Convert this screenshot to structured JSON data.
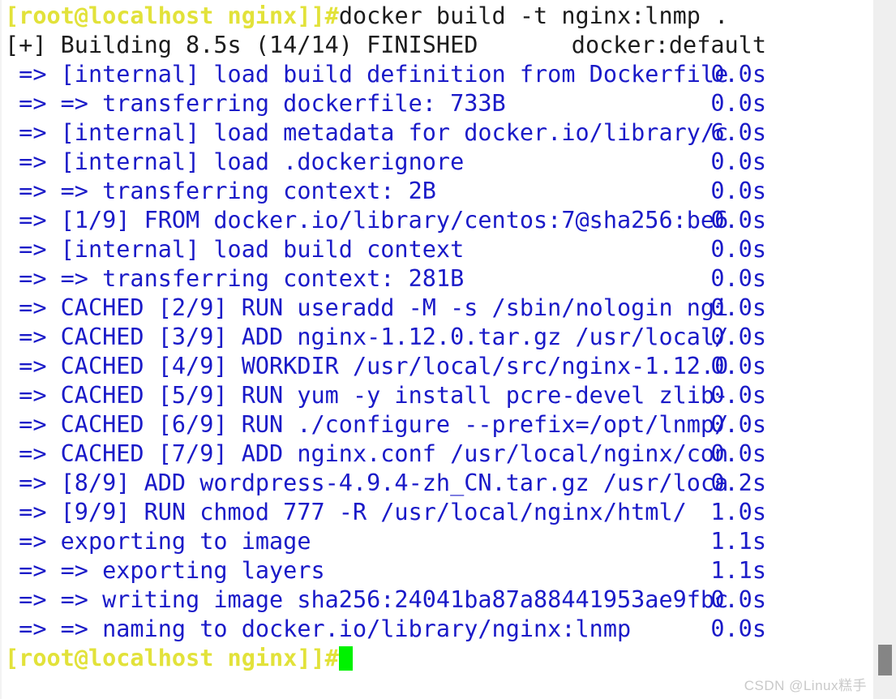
{
  "terminal": {
    "colors": {
      "background": "#ffffff",
      "prompt": "#e2e23a",
      "command": "#1c1c1c",
      "step": "#1a1ac8",
      "cursor": "#00f200",
      "scrollbar_track": "#efefef",
      "scrollbar_thumb": "#858585",
      "watermark": "#c9c9c9"
    },
    "prompt_text": "[root@localhost nginx]]#",
    "command": "docker build -t nginx:lnmp .",
    "lines": [
      {
        "kind": "prompt",
        "prompt": "[root@localhost nginx]]#",
        "command": "docker build -t nginx:lnmp ."
      },
      {
        "kind": "plain",
        "text": "[+] Building 8.5s (14/14) FINISHED",
        "right": "docker:default"
      },
      {
        "kind": "step",
        "text": " => [internal] load build definition from Dockerfile",
        "time": "0.0s"
      },
      {
        "kind": "step",
        "text": " => => transferring dockerfile: 733B",
        "time": "0.0s"
      },
      {
        "kind": "step",
        "text": " => [internal] load metadata for docker.io/library/c",
        "time": "6.0s"
      },
      {
        "kind": "step",
        "text": " => [internal] load .dockerignore",
        "time": "0.0s"
      },
      {
        "kind": "step",
        "text": " => => transferring context: 2B",
        "time": "0.0s"
      },
      {
        "kind": "step",
        "text": " => [1/9] FROM docker.io/library/centos:7@sha256:be6",
        "time": "0.0s"
      },
      {
        "kind": "step",
        "text": " => [internal] load build context",
        "time": "0.0s"
      },
      {
        "kind": "step",
        "text": " => => transferring context: 281B",
        "time": "0.0s"
      },
      {
        "kind": "step",
        "text": " => CACHED [2/9] RUN useradd -M -s /sbin/nologin ngi",
        "time": "0.0s"
      },
      {
        "kind": "step",
        "text": " => CACHED [3/9] ADD nginx-1.12.0.tar.gz /usr/local/",
        "time": "0.0s"
      },
      {
        "kind": "step",
        "text": " => CACHED [4/9] WORKDIR /usr/local/src/nginx-1.12.0",
        "time": "0.0s"
      },
      {
        "kind": "step",
        "text": " => CACHED [5/9] RUN yum -y install pcre-devel zlib-",
        "time": "0.0s"
      },
      {
        "kind": "step",
        "text": " => CACHED [6/9] RUN ./configure --prefix=/opt/lnmp/",
        "time": "0.0s"
      },
      {
        "kind": "step",
        "text": " => CACHED [7/9] ADD nginx.conf /usr/local/nginx/con",
        "time": "0.0s"
      },
      {
        "kind": "step",
        "text": " => [8/9] ADD wordpress-4.9.4-zh_CN.tar.gz /usr/loca",
        "time": "0.2s"
      },
      {
        "kind": "step",
        "text": " => [9/9] RUN chmod 777 -R /usr/local/nginx/html/",
        "time": "1.0s"
      },
      {
        "kind": "step",
        "text": " => exporting to image",
        "time": "1.1s"
      },
      {
        "kind": "step",
        "text": " => => exporting layers",
        "time": "1.1s"
      },
      {
        "kind": "step",
        "text": " => => writing image sha256:24041ba87a88441953ae9fbc",
        "time": "0.0s"
      },
      {
        "kind": "step",
        "text": " => => naming to docker.io/library/nginx:lnmp",
        "time": "0.0s"
      },
      {
        "kind": "cursor",
        "prompt": "[root@localhost nginx]]#"
      }
    ]
  },
  "watermark": {
    "text": "CSDN @Linux糕手"
  }
}
